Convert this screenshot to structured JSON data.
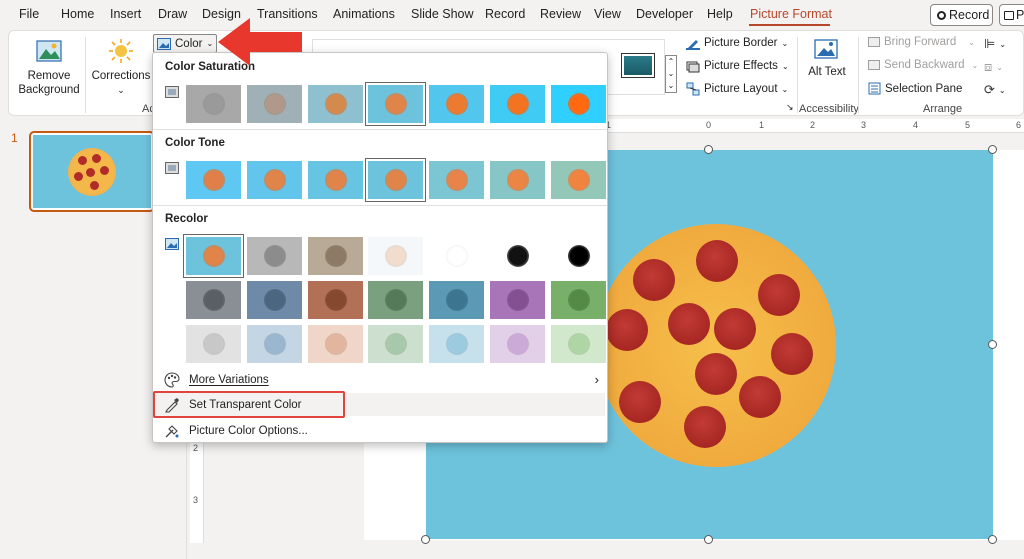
{
  "menubar": {
    "tabs": [
      "File",
      "Home",
      "Insert",
      "Draw",
      "Design",
      "Transitions",
      "Animations",
      "Slide Show",
      "Record",
      "Review",
      "View",
      "Developer",
      "Help",
      "Picture Format"
    ],
    "active_tab": "Picture Format",
    "record_button": "Record",
    "present_button": "P"
  },
  "ribbon": {
    "remove_background": "Remove Background",
    "corrections": "Corrections",
    "color_button": "Color",
    "adjust_group_label": "Ac",
    "picture_border": "Picture Border",
    "picture_effects": "Picture Effects",
    "picture_layout": "Picture Layout",
    "alt_text": "Alt Text",
    "accessibility_label": "Accessibility",
    "bring_forward": "Bring Forward",
    "send_backward": "Send Backward",
    "selection_pane": "Selection Pane",
    "arrange_label": "Arrange"
  },
  "thumbnails": {
    "slide_number": "1"
  },
  "ruler": {
    "top_numbers": [
      "1",
      "0",
      "1",
      "2",
      "3",
      "4",
      "5",
      "6"
    ],
    "left_numbers": [
      "2",
      "3"
    ]
  },
  "color_menu": {
    "saturation_title": "Color Saturation",
    "tone_title": "Color Tone",
    "recolor_title": "Recolor",
    "saturation_swatches": [
      {
        "bg": "#a8a8a8",
        "pizza": "#9a9a9a"
      },
      {
        "bg": "#9fb0b6",
        "pizza": "#b0998a"
      },
      {
        "bg": "#8fc0d0",
        "pizza": "#d48a4c"
      },
      {
        "bg": "#6ec3dc",
        "pizza": "#e0844a"
      },
      {
        "bg": "#52c6ec",
        "pizza": "#ec7a30"
      },
      {
        "bg": "#40cbf4",
        "pizza": "#f47320"
      },
      {
        "bg": "#2fd0ff",
        "pizza": "#ff6a10"
      }
    ],
    "tone_swatches": [
      {
        "bg": "#5ec8f2",
        "pizza": "#e08048"
      },
      {
        "bg": "#62c6ec",
        "pizza": "#e0844a"
      },
      {
        "bg": "#67c4e3",
        "pizza": "#e0844a"
      },
      {
        "bg": "#6ec3dc",
        "pizza": "#e0844a"
      },
      {
        "bg": "#7cc5d2",
        "pizza": "#e8844a"
      },
      {
        "bg": "#86c6c6",
        "pizza": "#ec8444"
      },
      {
        "bg": "#93c7b8",
        "pizza": "#f0843e"
      }
    ],
    "recolor_row1": [
      {
        "bg": "#6ec3dc",
        "pizza": "#e0844a"
      },
      {
        "bg": "#b8b8b8",
        "pizza": "#8c8c8c"
      },
      {
        "bg": "#b9aa98",
        "pizza": "#8c7a66"
      },
      {
        "bg": "#f4f8fb",
        "pizza": "#f2dccb"
      },
      {
        "bg": "#ffffff",
        "pizza": "#ffffff"
      },
      {
        "bg": "#ffffff",
        "pizza": "#111111"
      },
      {
        "bg": "#ffffff",
        "pizza": "#000000"
      }
    ],
    "recolor_row2": [
      {
        "bg": "#8a8f96",
        "pizza": "#5a5f66"
      },
      {
        "bg": "#6d8aa8",
        "pizza": "#4a6680"
      },
      {
        "bg": "#b27156",
        "pizza": "#85492f"
      },
      {
        "bg": "#7ba07f",
        "pizza": "#557a58"
      },
      {
        "bg": "#5b99b5",
        "pizza": "#3b7590"
      },
      {
        "bg": "#a876b8",
        "pizza": "#845092"
      },
      {
        "bg": "#78b06a",
        "pizza": "#548a46"
      }
    ],
    "recolor_row3": [
      {
        "bg": "#e2e2e2",
        "pizza": "#c8c8c8"
      },
      {
        "bg": "#c4d5e3",
        "pizza": "#9ab7cf"
      },
      {
        "bg": "#f0d6c8",
        "pizza": "#e2b59e"
      },
      {
        "bg": "#cde0cf",
        "pizza": "#a8c8ab"
      },
      {
        "bg": "#c6e0ec",
        "pizza": "#9ccbe0"
      },
      {
        "bg": "#e2cfe8",
        "pizza": "#ccaad8"
      },
      {
        "bg": "#d2e8cc",
        "pizza": "#aed6a4"
      }
    ],
    "more_variations": "More Variations",
    "set_transparent_color": "Set Transparent Color",
    "picture_color_options": "Picture Color Options..."
  },
  "colors": {
    "accent": "#b7472a",
    "highlight_box": "#e0443a",
    "arrow": "#e8372c",
    "slide_bg": "#6ec3dc"
  }
}
